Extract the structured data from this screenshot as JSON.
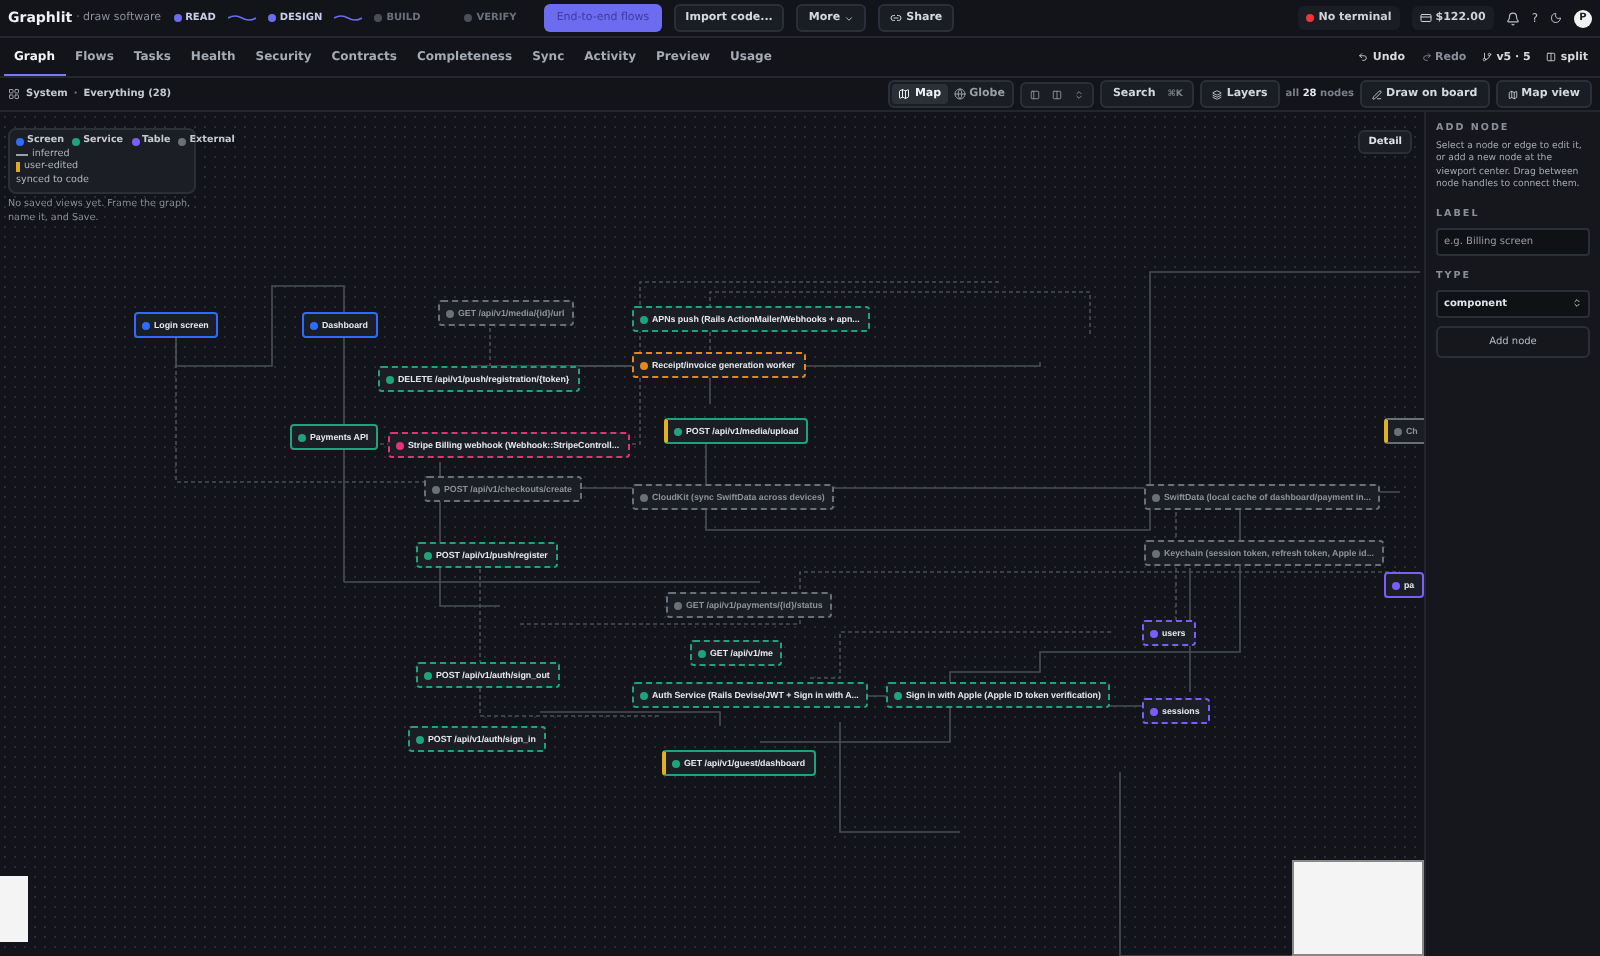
{
  "header": {
    "app_name": "Graphlit",
    "subtitle": "· draw software",
    "stages": [
      {
        "label": "READ",
        "done": true
      },
      {
        "label": "DESIGN",
        "done": true
      },
      {
        "label": "BUILD",
        "done": false
      },
      {
        "label": "VERIFY",
        "done": false
      }
    ],
    "primary_action": "End-to-end flows",
    "actions": [
      {
        "label": "Import code...",
        "kind": "plain"
      },
      {
        "label": "More",
        "kind": "menu"
      },
      {
        "label": "Share",
        "kind": "link"
      }
    ],
    "terminal": {
      "label": "No terminal",
      "connected": false
    },
    "balance": "$122.00",
    "help": "?",
    "avatar": "P"
  },
  "tabs": [
    {
      "label": "Graph",
      "selected": true
    },
    {
      "label": "Flows",
      "selected": false
    },
    {
      "label": "Tasks",
      "selected": false
    },
    {
      "label": "Health",
      "selected": false
    },
    {
      "label": "Security",
      "selected": false
    },
    {
      "label": "Contracts",
      "selected": false
    },
    {
      "label": "Completeness",
      "selected": false
    },
    {
      "label": "Sync",
      "selected": false
    },
    {
      "label": "Activity",
      "selected": false
    },
    {
      "label": "Preview",
      "selected": false
    },
    {
      "label": "Usage",
      "selected": false
    }
  ],
  "history": {
    "undo": "Undo",
    "redo": "Redo",
    "version": "v5 · 5",
    "split": "split"
  },
  "scope": {
    "label": "System",
    "separator": "·",
    "filter": "Everything (28)"
  },
  "view_modes": [
    {
      "label": "Map",
      "selected": true
    },
    {
      "label": "Globe",
      "selected": false
    }
  ],
  "search": {
    "label": "Search",
    "shortcut": "⌘K"
  },
  "layers": "Layers",
  "node_count": {
    "prefix": "all",
    "count": "28",
    "suffix": "nodes"
  },
  "draw_button": "Draw on board",
  "map_view_button": "Map view",
  "legend": {
    "kinds": [
      {
        "label": "Screen",
        "color": "#2f6bff"
      },
      {
        "label": "Service",
        "color": "#1fa37a"
      },
      {
        "label": "Table",
        "color": "#7a5cff"
      },
      {
        "label": "External",
        "color": "#6b6f78"
      }
    ],
    "line_styles": [
      {
        "label": "inferred",
        "kind": "dashed"
      },
      {
        "label": "user-edited",
        "kind": "bar"
      },
      {
        "label": "synced to code",
        "kind": "plain"
      }
    ]
  },
  "saved_views_hint": "No saved views yet. Frame the graph, name it, and Save.",
  "detail_button": "Detail",
  "nodes": [
    {
      "label": "Login screen",
      "kind": "screen",
      "dashed": false,
      "pinned": false
    },
    {
      "label": "Dashboard",
      "kind": "screen",
      "dashed": false,
      "pinned": false
    },
    {
      "label": "GET /api/v1/media/{id}/url",
      "kind": "external",
      "dashed": true,
      "pinned": false
    },
    {
      "label": "APNs push (Rails ActionMailer/Webhooks + apn...",
      "kind": "service",
      "dashed": true,
      "pinned": false
    },
    {
      "label": "DELETE /api/v1/push/registration/{token}",
      "kind": "service",
      "dashed": true,
      "pinned": false
    },
    {
      "label": "Receipt/invoice generation worker",
      "kind": "worker",
      "dashed": true,
      "pinned": false
    },
    {
      "label": "Payments API",
      "kind": "service",
      "dashed": false,
      "pinned": false
    },
    {
      "label": "Stripe Billing webhook (Webhook::StripeControll...",
      "kind": "webhook",
      "dashed": true,
      "pinned": false
    },
    {
      "label": "POST /api/v1/media/upload",
      "kind": "service",
      "dashed": false,
      "pinned": true
    },
    {
      "label": "POST /api/v1/checkouts/create",
      "kind": "external",
      "dashed": true,
      "pinned": false
    },
    {
      "label": "CloudKit (sync SwiftData across devices)",
      "kind": "external",
      "dashed": true,
      "pinned": false
    },
    {
      "label": "SwiftData (local cache of dashboard/payment in...",
      "kind": "external",
      "dashed": true,
      "pinned": false
    },
    {
      "label": "POST /api/v1/push/register",
      "kind": "service",
      "dashed": true,
      "pinned": false
    },
    {
      "label": "Keychain (session token, refresh token, Apple id...",
      "kind": "external",
      "dashed": true,
      "pinned": false
    },
    {
      "label": "GET /api/v1/payments/{id}/status",
      "kind": "external",
      "dashed": true,
      "pinned": false
    },
    {
      "label": "users",
      "kind": "table",
      "dashed": true,
      "pinned": false
    },
    {
      "label": "GET /api/v1/me",
      "kind": "service",
      "dashed": true,
      "pinned": false
    },
    {
      "label": "POST /api/v1/auth/sign_out",
      "kind": "service",
      "dashed": true,
      "pinned": false
    },
    {
      "label": "Auth Service (Rails Devise/JWT + Sign in with A...",
      "kind": "service",
      "dashed": true,
      "pinned": false
    },
    {
      "label": "Sign in with Apple (Apple ID token verification)",
      "kind": "service",
      "dashed": true,
      "pinned": false
    },
    {
      "label": "sessions",
      "kind": "table",
      "dashed": true,
      "pinned": false
    },
    {
      "label": "POST /api/v1/auth/sign_in",
      "kind": "service",
      "dashed": true,
      "pinned": false
    },
    {
      "label": "GET /api/v1/guest/dashboard",
      "kind": "service",
      "dashed": false,
      "pinned": true
    },
    {
      "label": "Ch",
      "kind": "external",
      "dashed": false,
      "pinned": true
    },
    {
      "label": "pa",
      "kind": "table",
      "dashed": false,
      "pinned": false
    }
  ],
  "add_node": {
    "heading": "ADD NODE",
    "description": "Select a node or edge to edit it, or add a new node at the viewport center. Drag between node handles to connect them.",
    "label_heading": "LABEL",
    "label_placeholder": "e.g. Billing screen",
    "type_heading": "TYPE",
    "type_value": "component",
    "button": "Add node"
  }
}
